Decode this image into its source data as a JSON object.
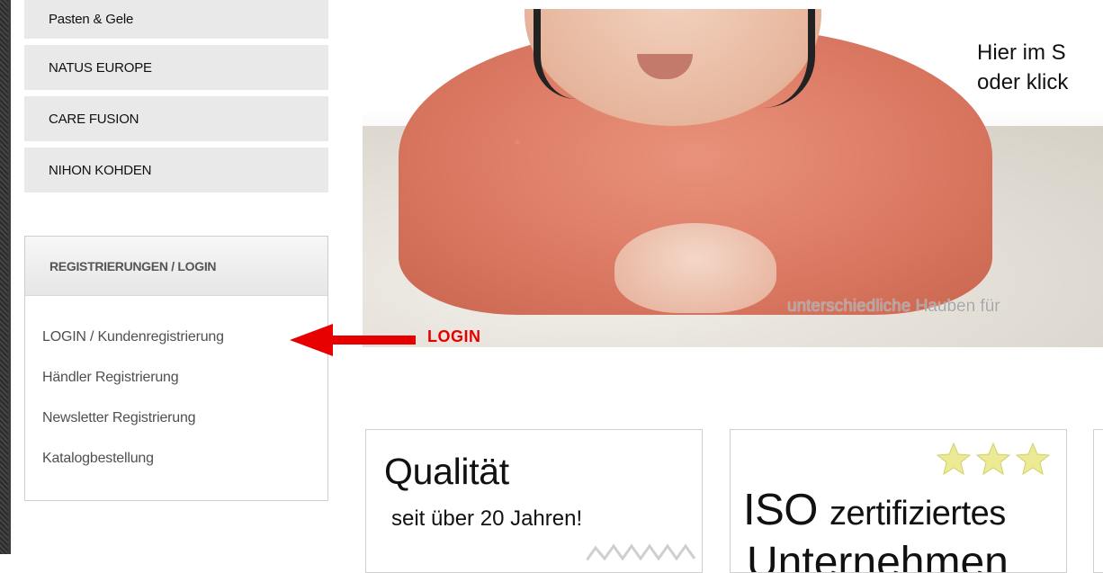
{
  "brand_menu": {
    "items": [
      {
        "label": "Pasten & Gele"
      },
      {
        "label": "NATUS EUROPE"
      },
      {
        "label": "CARE FUSION"
      },
      {
        "label": "NIHON KOHDEN"
      }
    ]
  },
  "registration": {
    "heading": "REGISTRIERUNGEN / LOGIN",
    "links": [
      {
        "label": "LOGIN / Kundenregistrierung"
      },
      {
        "label": "Händler Registrierung"
      },
      {
        "label": "Newsletter Registrierung"
      },
      {
        "label": "Katalogbestellung"
      }
    ]
  },
  "hero": {
    "text_line1": "Hier im S",
    "text_line2": "oder klick",
    "caption": "unterschiedliche Hauben für"
  },
  "annotation": {
    "label": "LOGIN",
    "color": "#e60000"
  },
  "cards": {
    "quality": {
      "title": "Qualität",
      "subtitle": "seit über 20 Jahren!"
    },
    "iso": {
      "title_big": "ISO",
      "title_small": "zertifiziertes",
      "subtitle": "Unternehmen"
    }
  }
}
